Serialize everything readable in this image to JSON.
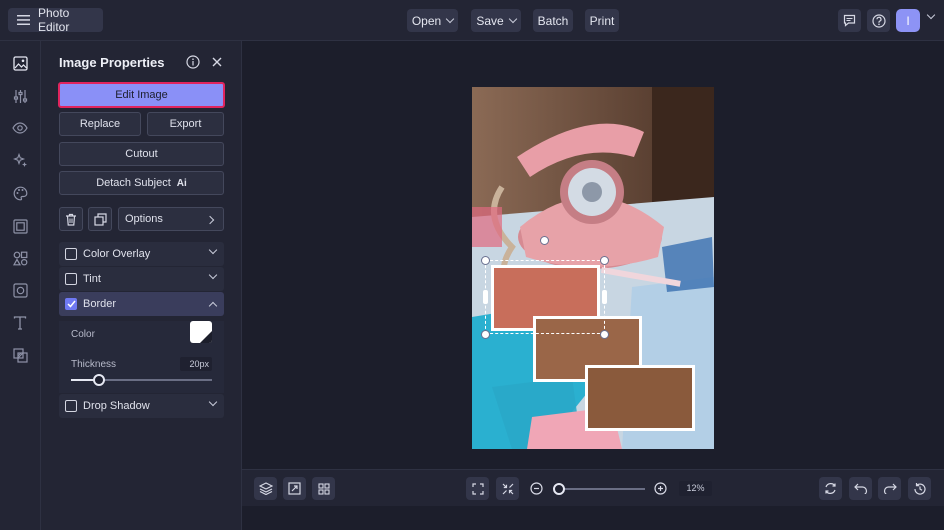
{
  "app": {
    "title": "Photo Editor"
  },
  "toolbar": {
    "open_label": "Open",
    "save_label": "Save",
    "batch_label": "Batch",
    "print_label": "Print",
    "avatar_initial": "I"
  },
  "sidebar": {
    "icons": [
      "image-icon",
      "adjustments-icon",
      "eye-icon",
      "sparkle-icon",
      "palette-icon",
      "frame-icon",
      "shapes-icon",
      "texture-icon",
      "text-icon",
      "overlay-icon"
    ]
  },
  "panel": {
    "title": "Image Properties",
    "edit_image_label": "Edit Image",
    "replace_label": "Replace",
    "export_label": "Export",
    "cutout_label": "Cutout",
    "detach_subject_label": "Detach Subject",
    "ai_badge": "Ai",
    "options_label": "Options",
    "sections": [
      {
        "label": "Color Overlay",
        "checked": false,
        "expanded": false
      },
      {
        "label": "Tint",
        "checked": false,
        "expanded": false
      },
      {
        "label": "Border",
        "checked": true,
        "expanded": true
      },
      {
        "label": "Drop Shadow",
        "checked": false,
        "expanded": false
      }
    ],
    "border": {
      "color_label": "Color",
      "color_value": "#ffffff",
      "thickness_label": "Thickness",
      "thickness_value": "20px",
      "thickness_fraction": 0.2
    }
  },
  "bottombar": {
    "zoom_value": "12%",
    "zoom_fraction": 0.0
  },
  "colors": {
    "accent": "#8a90f7",
    "highlight_border": "#e0245e",
    "checkbox_checked": "#6f79f3"
  }
}
